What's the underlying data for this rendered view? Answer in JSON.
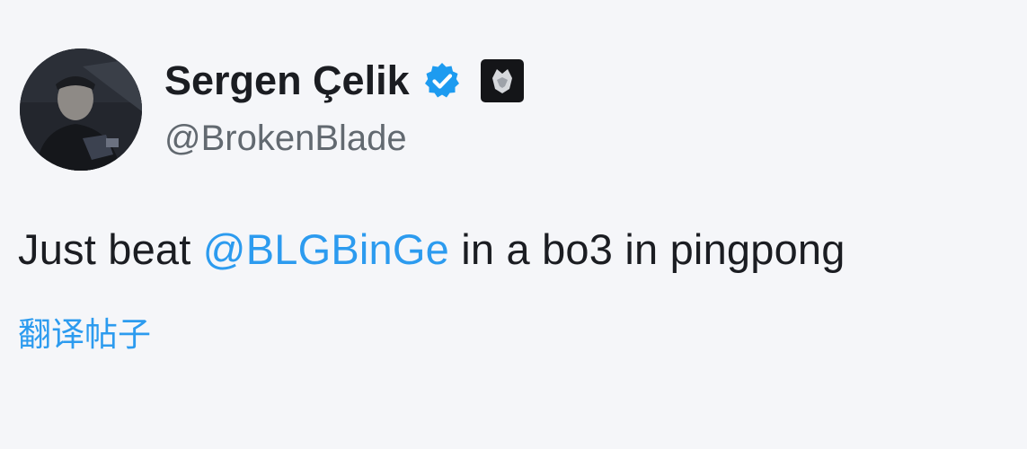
{
  "author": {
    "display_name": "Sergen Çelik",
    "handle": "@BrokenBlade",
    "verified_icon": "verified-check-icon",
    "verified_color": "#1d9bf0",
    "affiliate_badge_icon": "team-affiliate-badge-icon"
  },
  "tweet": {
    "text_before": "Just beat ",
    "mention": "@BLGBinGe",
    "text_after": " in a bo3 in pingpong"
  },
  "translate_label": "翻译帖子",
  "colors": {
    "link": "#2c9bef",
    "text": "#1b1d22",
    "muted": "#626970",
    "background": "#f5f6f9"
  }
}
